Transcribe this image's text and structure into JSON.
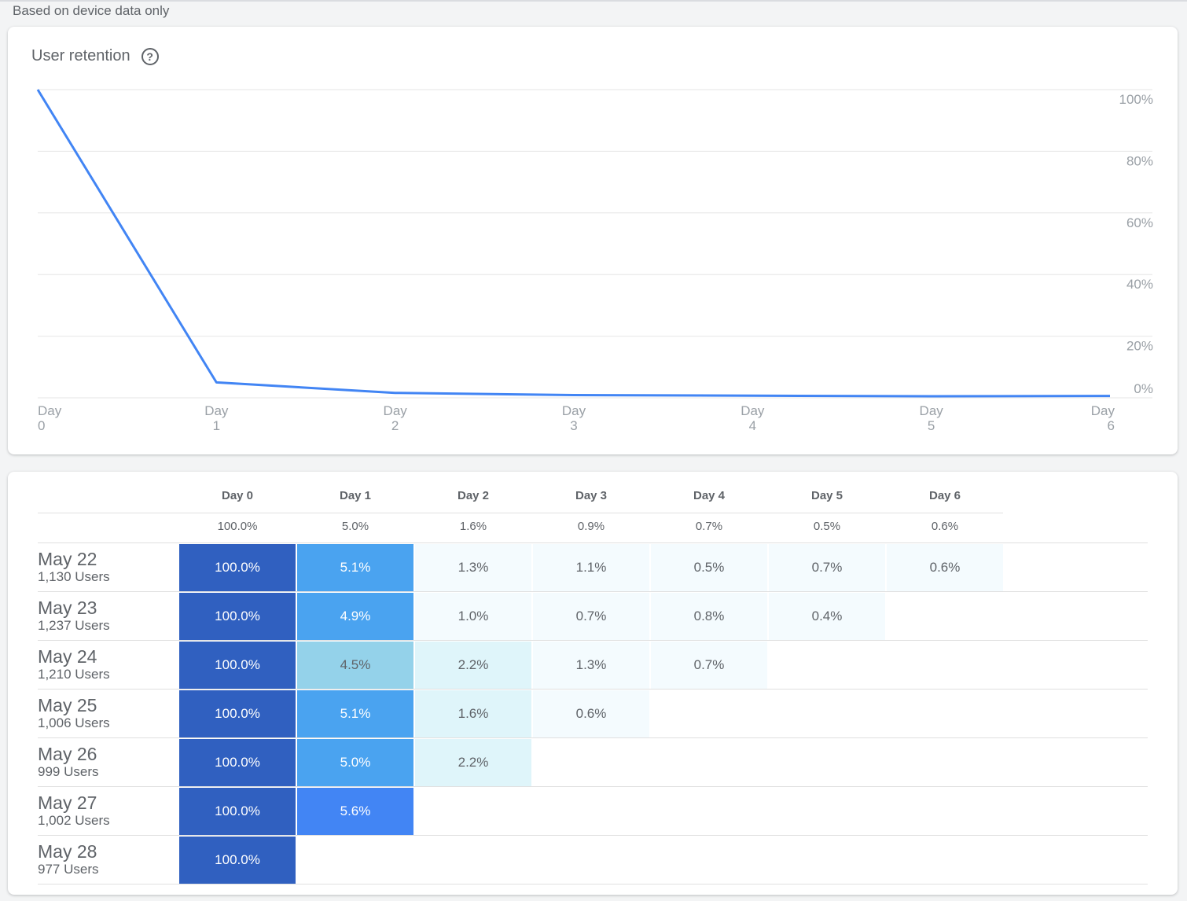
{
  "note": "Based on device data only",
  "chart_card": {
    "title": "User retention",
    "help_icon": "help-circle-icon"
  },
  "chart_data": {
    "type": "line",
    "x": [
      "Day 0",
      "Day 1",
      "Day 2",
      "Day 3",
      "Day 4",
      "Day 5",
      "Day 6"
    ],
    "x_tick_top": [
      "Day",
      "Day",
      "Day",
      "Day",
      "Day",
      "Day",
      "Day"
    ],
    "x_tick_bottom": [
      "0",
      "1",
      "2",
      "3",
      "4",
      "5",
      "6"
    ],
    "series": [
      {
        "values": [
          100.0,
          5.0,
          1.6,
          0.9,
          0.7,
          0.5,
          0.6
        ],
        "color": "#4285f4"
      }
    ],
    "y_ticks": [
      "100%",
      "80%",
      "60%",
      "40%",
      "20%",
      "0%"
    ],
    "y_tick_values": [
      100,
      80,
      60,
      40,
      20,
      0
    ],
    "ylim": [
      0,
      100
    ],
    "grid": true,
    "y_axis_side": "right"
  },
  "table": {
    "columns": [
      "Day 0",
      "Day 1",
      "Day 2",
      "Day 3",
      "Day 4",
      "Day 5",
      "Day 6"
    ],
    "averages": [
      "100.0%",
      "5.0%",
      "1.6%",
      "0.9%",
      "0.7%",
      "0.5%",
      "0.6%"
    ],
    "rows": [
      {
        "date": "May 22",
        "users": "1,130 Users",
        "values": [
          "100.0%",
          "5.1%",
          "1.3%",
          "1.1%",
          "0.5%",
          "0.7%",
          "0.6%"
        ],
        "colors": [
          "#3060c0",
          "#4aa3f0",
          "#f4fbfe",
          "#f4fbfe",
          "#f4fbfe",
          "#f4fbfe",
          "#f4fbfe"
        ]
      },
      {
        "date": "May 23",
        "users": "1,237 Users",
        "values": [
          "100.0%",
          "4.9%",
          "1.0%",
          "0.7%",
          "0.8%",
          "0.4%"
        ],
        "colors": [
          "#3060c0",
          "#4aa3f0",
          "#f4fbfe",
          "#f4fbfe",
          "#f4fbfe",
          "#f4fbfe"
        ]
      },
      {
        "date": "May 24",
        "users": "1,210 Users",
        "values": [
          "100.0%",
          "4.5%",
          "2.2%",
          "1.3%",
          "0.7%"
        ],
        "colors": [
          "#3060c0",
          "#94d2ea",
          "#dff5fa",
          "#f4fbfe",
          "#f4fbfe"
        ]
      },
      {
        "date": "May 25",
        "users": "1,006 Users",
        "values": [
          "100.0%",
          "5.1%",
          "1.6%",
          "0.6%"
        ],
        "colors": [
          "#3060c0",
          "#4aa3f0",
          "#dff5fa",
          "#f4fbfe"
        ]
      },
      {
        "date": "May 26",
        "users": "999 Users",
        "values": [
          "100.0%",
          "5.0%",
          "2.2%"
        ],
        "colors": [
          "#3060c0",
          "#4aa3f0",
          "#dff5fa"
        ]
      },
      {
        "date": "May 27",
        "users": "1,002 Users",
        "values": [
          "100.0%",
          "5.6%"
        ],
        "colors": [
          "#3060c0",
          "#4285f4"
        ]
      },
      {
        "date": "May 28",
        "users": "977 Users",
        "values": [
          "100.0%"
        ],
        "colors": [
          "#3060c0"
        ]
      }
    ]
  }
}
